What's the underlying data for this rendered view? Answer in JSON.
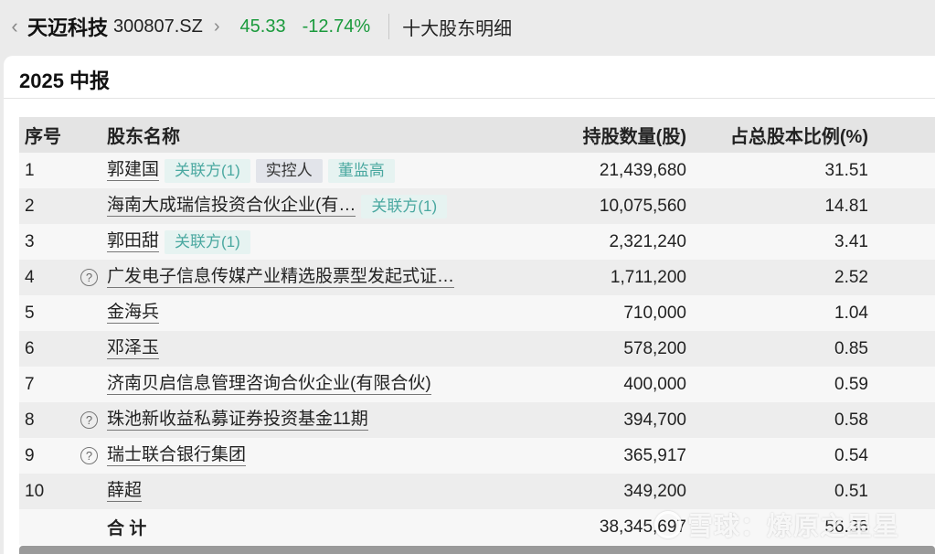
{
  "header": {
    "stock_name": "天迈科技",
    "stock_code": "300807.SZ",
    "price": "45.33",
    "change": "-12.74%",
    "page_title": "十大股东明细"
  },
  "report_period": "2025 中报",
  "table": {
    "columns": [
      "序号",
      "股东名称",
      "持股数量(股)",
      "占总股本比例(%)"
    ],
    "rows": [
      {
        "idx": "1",
        "name": "郭建国",
        "tags": [
          "关联方(1)",
          "实控人",
          "董监高"
        ],
        "shares": "21,439,680",
        "pct": "31.51"
      },
      {
        "idx": "2",
        "name": "海南大成瑞信投资合伙企业(有…",
        "tags": [
          "关联方(1)"
        ],
        "shares": "10,075,560",
        "pct": "14.81"
      },
      {
        "idx": "3",
        "name": "郭田甜",
        "tags": [
          "关联方(1)"
        ],
        "shares": "2,321,240",
        "pct": "3.41"
      },
      {
        "idx": "4",
        "name": "广发电子信息传媒产业精选股票型发起式证…",
        "tags": [],
        "shares": "1,711,200",
        "pct": "2.52"
      },
      {
        "idx": "5",
        "name": "金海兵",
        "tags": [],
        "shares": "710,000",
        "pct": "1.04"
      },
      {
        "idx": "6",
        "name": "邓泽玉",
        "tags": [],
        "shares": "578,200",
        "pct": "0.85"
      },
      {
        "idx": "7",
        "name": "济南贝启信息管理咨询合伙企业(有限合伙)",
        "tags": [],
        "shares": "400,000",
        "pct": "0.59"
      },
      {
        "idx": "8",
        "name": "珠池新收益私募证券投资基金11期",
        "tags": [],
        "shares": "394,700",
        "pct": "0.58"
      },
      {
        "idx": "9",
        "name": "瑞士联合银行集团",
        "tags": [],
        "shares": "365,917",
        "pct": "0.54"
      },
      {
        "idx": "10",
        "name": "薛超",
        "tags": [],
        "shares": "349,200",
        "pct": "0.51"
      }
    ],
    "total_label": "合 计",
    "total_shares": "38,345,697",
    "total_pct": "56.36"
  },
  "watermark": "雪球：燎原之星星",
  "icons": {
    "back": "chevron-left-icon",
    "forward": "chevron-right-icon",
    "help": "question-circle-icon"
  },
  "colors": {
    "down": "#1a9a3c",
    "tag_teal": "#4aa8a0"
  }
}
